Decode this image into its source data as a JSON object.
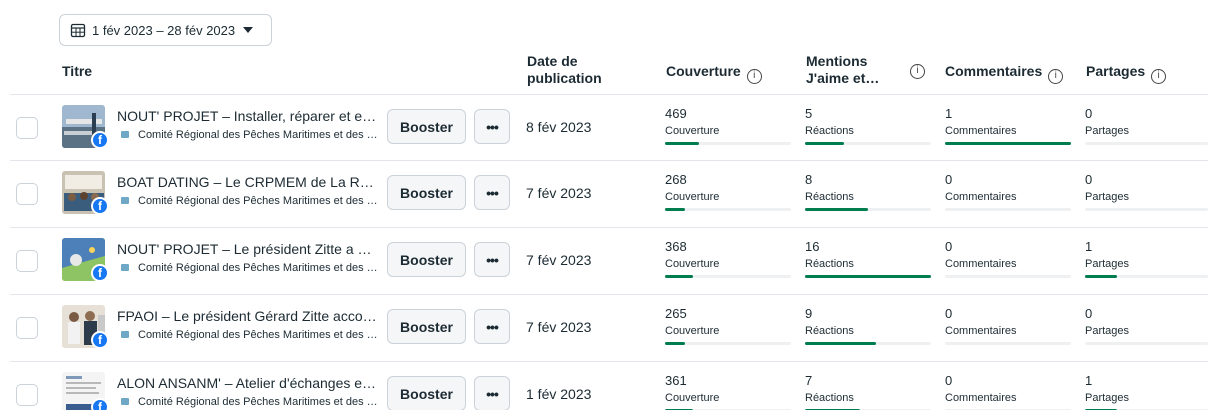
{
  "date_range": {
    "label": "1 fév 2023 – 28 fév 2023"
  },
  "headers": {
    "titre": "Titre",
    "date_pub_line1": "Date de",
    "date_pub_line2": "publication",
    "couverture": "Couverture",
    "mentions_line1": "Mentions",
    "mentions_line2": "J'aime et…",
    "commentaires": "Commentaires",
    "partages": "Partages",
    "info_symbol": "i"
  },
  "booster_label": "Booster",
  "more_label": "•••",
  "fb_badge": "f",
  "rows": [
    {
      "title": "NOUT' PROJET – Installer, réparer et entretenir",
      "page": "Comité Régional des Pêches Maritimes et des Élevages Marins",
      "date": "8 fév 2023",
      "thumb": "harbor-pier",
      "couverture": {
        "value": "469",
        "label": "Couverture",
        "fill": 0.27
      },
      "reactions": {
        "value": "5",
        "label": "Réactions",
        "fill": 0.31
      },
      "commentaires": {
        "value": "1",
        "label": "Commentaires",
        "fill": 1.0
      },
      "partages": {
        "value": "0",
        "label": "Partages",
        "fill": 0.0
      }
    },
    {
      "title": "BOAT DATING – Le CRPMEM de La Réunion a",
      "page": "Comité Régional des Pêches Maritimes et des Élevages Marins",
      "date": "7 fév 2023",
      "thumb": "meeting-room",
      "couverture": {
        "value": "268",
        "label": "Couverture",
        "fill": 0.16
      },
      "reactions": {
        "value": "8",
        "label": "Réactions",
        "fill": 0.5
      },
      "commentaires": {
        "value": "0",
        "label": "Commentaires",
        "fill": 0.0
      },
      "partages": {
        "value": "0",
        "label": "Partages",
        "fill": 0.0
      }
    },
    {
      "title": "NOUT' PROJET – Le président Zitte a profité de",
      "page": "Comité Régional des Pêches Maritimes et des Élevages Marins",
      "date": "7 fév 2023",
      "thumb": "map-graphic",
      "couverture": {
        "value": "368",
        "label": "Couverture",
        "fill": 0.22
      },
      "reactions": {
        "value": "16",
        "label": "Réactions",
        "fill": 1.0
      },
      "commentaires": {
        "value": "0",
        "label": "Commentaires",
        "fill": 0.0
      },
      "partages": {
        "value": "1",
        "label": "Partages",
        "fill": 0.26
      }
    },
    {
      "title": "FPAOI – Le président Gérard Zitte accompagne",
      "page": "Comité Régional des Pêches Maritimes et des Élevages Marins",
      "date": "7 fév 2023",
      "thumb": "group-photo",
      "couverture": {
        "value": "265",
        "label": "Couverture",
        "fill": 0.16
      },
      "reactions": {
        "value": "9",
        "label": "Réactions",
        "fill": 0.56
      },
      "commentaires": {
        "value": "0",
        "label": "Commentaires",
        "fill": 0.0
      },
      "partages": {
        "value": "0",
        "label": "Partages",
        "fill": 0.0
      }
    },
    {
      "title": "ALON ANSANM' – Atelier d'échanges entre les",
      "page": "Comité Régional des Pêches Maritimes et des Élevages Marins",
      "date": "1 fév 2023",
      "thumb": "document-flyer",
      "couverture": {
        "value": "361",
        "label": "Couverture",
        "fill": 0.22
      },
      "reactions": {
        "value": "7",
        "label": "Réactions",
        "fill": 0.44
      },
      "commentaires": {
        "value": "0",
        "label": "Commentaires",
        "fill": 0.0
      },
      "partages": {
        "value": "1",
        "label": "Partages",
        "fill": 0.26
      }
    }
  ]
}
